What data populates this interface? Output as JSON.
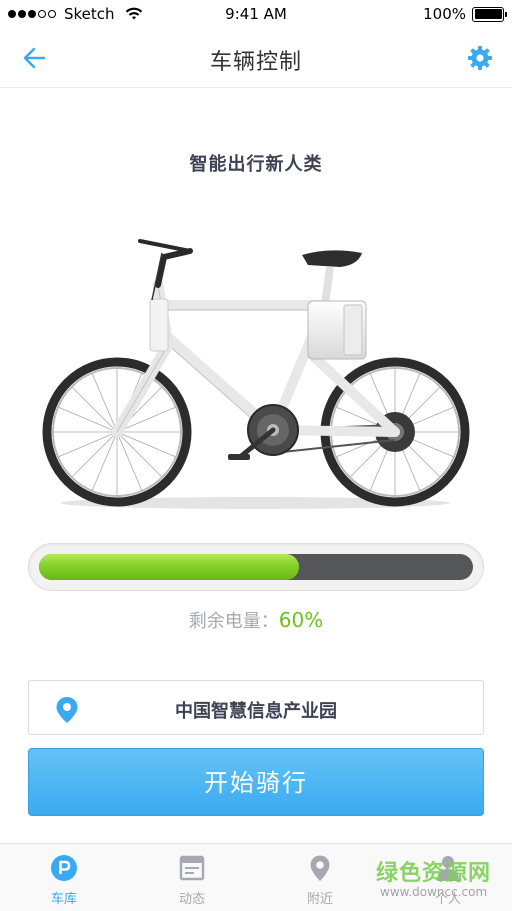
{
  "status_bar": {
    "carrier": "Sketch",
    "time": "9:41 AM",
    "battery": "100%"
  },
  "nav": {
    "title": "车辆控制",
    "back_icon": "arrow-left-icon",
    "settings_icon": "gear-icon"
  },
  "main": {
    "slogan": "智能出行新人类",
    "battery_label": "剩余电量：",
    "battery_value": "60%",
    "battery_level": 0.6,
    "location": "中国智慧信息产业园",
    "start_button": "开始骑行"
  },
  "tabs": [
    {
      "label": "车库",
      "icon": "parking-icon",
      "active": true
    },
    {
      "label": "动态",
      "icon": "news-icon",
      "active": false
    },
    {
      "label": "附近",
      "icon": "location-pin-icon",
      "active": false
    },
    {
      "label": "个人",
      "icon": "user-icon",
      "active": false
    }
  ],
  "watermark": {
    "title": "绿色资源网",
    "url": "www.downcc.com"
  },
  "colors": {
    "accent": "#3aaaf0",
    "battery_green": "#6cc21f",
    "tab_inactive": "#a5a8b0"
  }
}
